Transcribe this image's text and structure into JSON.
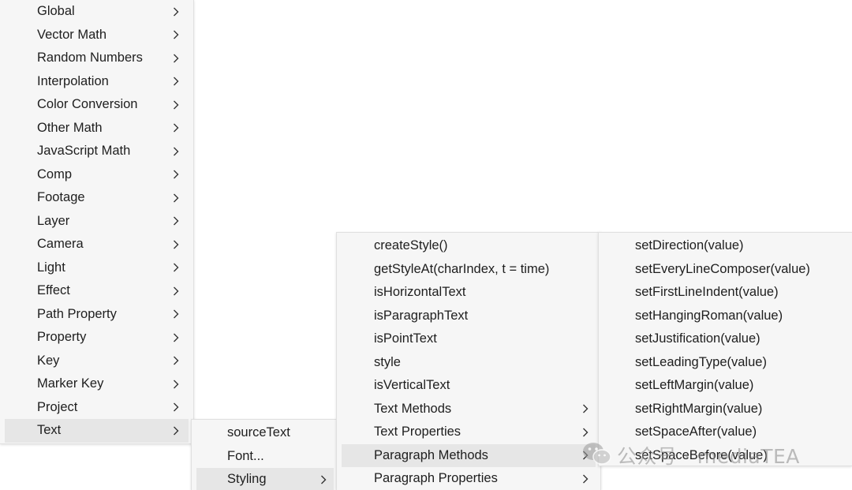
{
  "menus": {
    "main": {
      "items": [
        {
          "label": "Global",
          "has_submenu": true
        },
        {
          "label": "Vector Math",
          "has_submenu": true
        },
        {
          "label": "Random Numbers",
          "has_submenu": true
        },
        {
          "label": "Interpolation",
          "has_submenu": true
        },
        {
          "label": "Color Conversion",
          "has_submenu": true
        },
        {
          "label": "Other Math",
          "has_submenu": true
        },
        {
          "label": "JavaScript Math",
          "has_submenu": true
        },
        {
          "label": "Comp",
          "has_submenu": true
        },
        {
          "label": "Footage",
          "has_submenu": true
        },
        {
          "label": "Layer",
          "has_submenu": true
        },
        {
          "label": "Camera",
          "has_submenu": true
        },
        {
          "label": "Light",
          "has_submenu": true
        },
        {
          "label": "Effect",
          "has_submenu": true
        },
        {
          "label": "Path Property",
          "has_submenu": true
        },
        {
          "label": "Property",
          "has_submenu": true
        },
        {
          "label": "Key",
          "has_submenu": true
        },
        {
          "label": "Marker Key",
          "has_submenu": true
        },
        {
          "label": "Project",
          "has_submenu": true
        },
        {
          "label": "Text",
          "has_submenu": true,
          "highlighted": true
        }
      ]
    },
    "text": {
      "items": [
        {
          "label": "sourceText",
          "has_submenu": false
        },
        {
          "label": "Font...",
          "has_submenu": false
        },
        {
          "label": "Styling",
          "has_submenu": true,
          "highlighted": true
        }
      ]
    },
    "styling": {
      "items": [
        {
          "label": "createStyle()",
          "has_submenu": false
        },
        {
          "label": "getStyleAt(charIndex, t = time)",
          "has_submenu": false
        },
        {
          "label": "isHorizontalText",
          "has_submenu": false
        },
        {
          "label": "isParagraphText",
          "has_submenu": false
        },
        {
          "label": "isPointText",
          "has_submenu": false
        },
        {
          "label": "style",
          "has_submenu": false
        },
        {
          "label": "isVerticalText",
          "has_submenu": false
        },
        {
          "label": "Text Methods",
          "has_submenu": true
        },
        {
          "label": "Text Properties",
          "has_submenu": true
        },
        {
          "label": "Paragraph Methods",
          "has_submenu": true,
          "highlighted": true
        },
        {
          "label": "Paragraph Properties",
          "has_submenu": true
        }
      ]
    },
    "paragraph_methods": {
      "items": [
        {
          "label": "setDirection(value)",
          "has_submenu": false
        },
        {
          "label": "setEveryLineComposer(value)",
          "has_submenu": false
        },
        {
          "label": "setFirstLineIndent(value)",
          "has_submenu": false
        },
        {
          "label": "setHangingRoman(value)",
          "has_submenu": false
        },
        {
          "label": "setJustification(value)",
          "has_submenu": false
        },
        {
          "label": "setLeadingType(value)",
          "has_submenu": false
        },
        {
          "label": "setLeftMargin(value)",
          "has_submenu": false
        },
        {
          "label": "setRightMargin(value)",
          "has_submenu": false
        },
        {
          "label": "setSpaceAfter(value)",
          "has_submenu": false
        },
        {
          "label": "setSpaceBefore(value)",
          "has_submenu": false
        }
      ]
    }
  },
  "watermark": {
    "text": "公众号 · mediaTEA",
    "icon": "wechat-icon"
  },
  "colors": {
    "menu_bg": "#f6f6f6",
    "highlight_bg": "#e6e6e6",
    "text": "#1e1e1e",
    "arrow": "#333333"
  },
  "icons": {
    "submenu_arrow": "chevron-right-icon"
  }
}
